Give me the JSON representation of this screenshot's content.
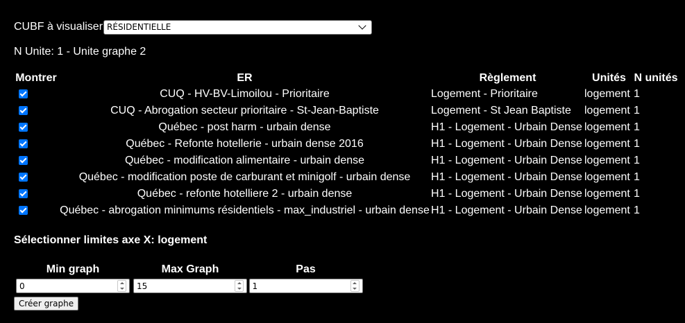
{
  "cubf": {
    "label": "CUBF à visualiser",
    "selected": "RÉSIDENTIELLE"
  },
  "n_unite_text": "N Unite: 1 - Unite graphe 2",
  "table": {
    "headers": {
      "show": "Montrer",
      "er": "ER",
      "reglement": "Règlement",
      "units": "Unités",
      "n_units": "N unités"
    },
    "rows": [
      {
        "checked": true,
        "er": "CUQ - HV-BV-Limoilou - Prioritaire",
        "reglement": "Logement - Prioritaire",
        "units": "logement",
        "n_units": "1"
      },
      {
        "checked": true,
        "er": "CUQ - Abrogation secteur prioritaire - St-Jean-Baptiste",
        "reglement": "Logement - St Jean Baptiste",
        "units": "logement",
        "n_units": "1"
      },
      {
        "checked": true,
        "er": "Québec - post harm - urbain dense",
        "reglement": "H1 - Logement - Urbain Dense",
        "units": "logement",
        "n_units": "1"
      },
      {
        "checked": true,
        "er": "Québec - Refonte hotellerie - urbain dense 2016",
        "reglement": "H1 - Logement - Urbain Dense",
        "units": "logement",
        "n_units": "1"
      },
      {
        "checked": true,
        "er": "Québec - modification alimentaire - urbain dense",
        "reglement": "H1 - Logement - Urbain Dense",
        "units": "logement",
        "n_units": "1"
      },
      {
        "checked": true,
        "er": "Québec - modification poste de carburant et minigolf - urbain dense",
        "reglement": "H1 - Logement - Urbain Dense",
        "units": "logement",
        "n_units": "1"
      },
      {
        "checked": true,
        "er": "Québec - refonte hotelliere 2 - urbain dense",
        "reglement": "H1 - Logement - Urbain Dense",
        "units": "logement",
        "n_units": "1"
      },
      {
        "checked": true,
        "er": "Québec - abrogation minimums résidentiels - max_industriel - urbain dense",
        "reglement": "H1 - Logement - Urbain Dense",
        "units": "logement",
        "n_units": "1"
      }
    ]
  },
  "axis": {
    "title": "Sélectionner limites axe X: logement",
    "min_label": "Min graph",
    "min_value": "0",
    "max_label": "Max Graph",
    "max_value": "15",
    "step_label": "Pas",
    "step_value": "1"
  },
  "create_button": "Créer graphe",
  "colors": {
    "background": "#000000",
    "checkbox": "#0075ff"
  }
}
